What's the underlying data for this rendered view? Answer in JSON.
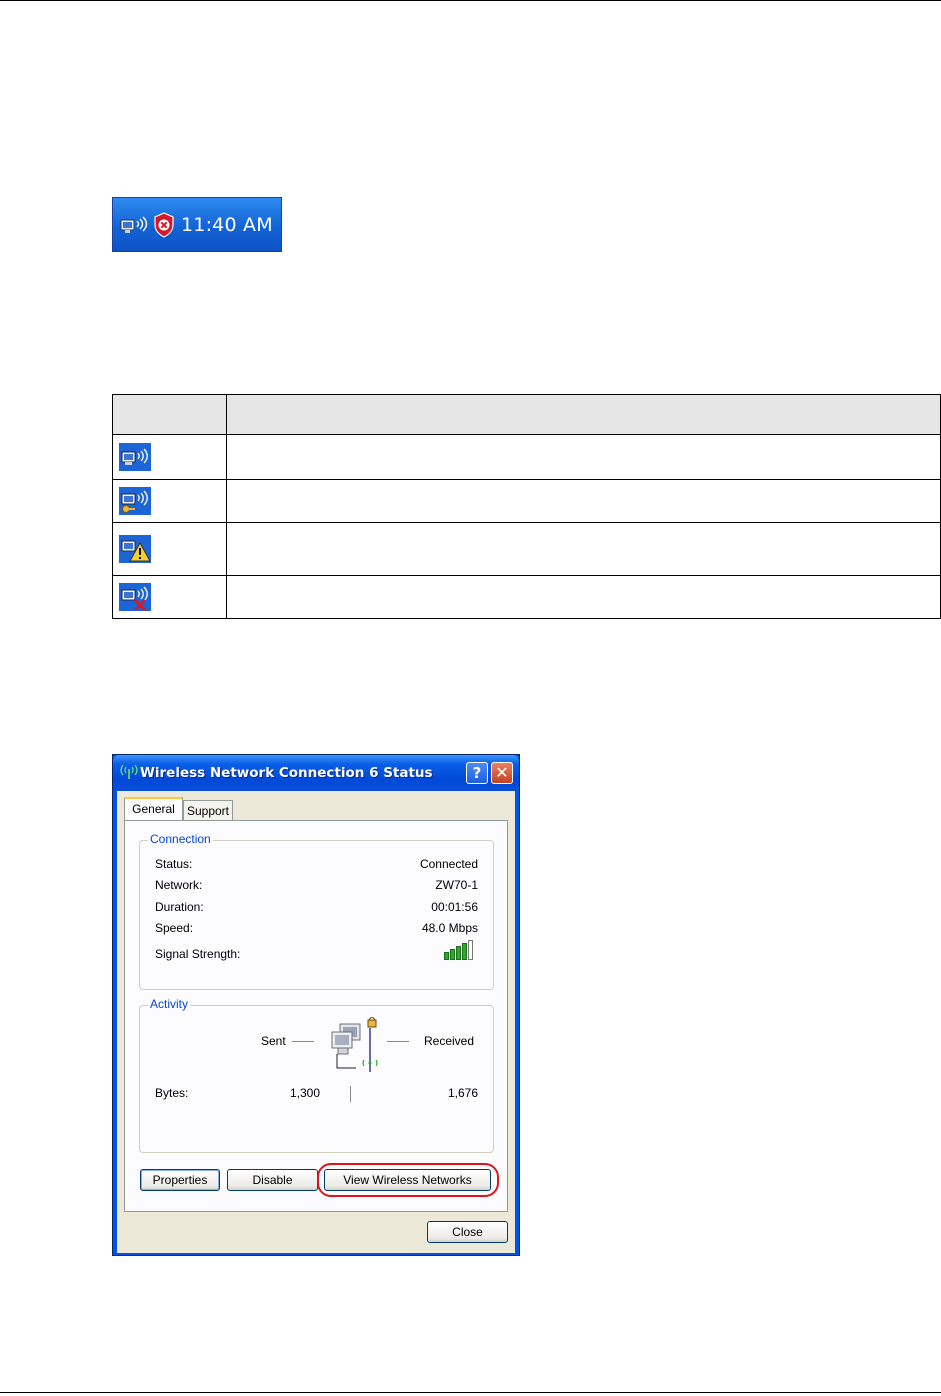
{
  "tray": {
    "clock": "11:40 AM"
  },
  "icon_table": {
    "rows": [
      {
        "icon": "wireless-connected-icon"
      },
      {
        "icon": "wireless-connecting-icon"
      },
      {
        "icon": "wireless-warning-icon"
      },
      {
        "icon": "wireless-disconnected-icon"
      }
    ]
  },
  "dialog": {
    "title": "Wireless Network Connection 6 Status",
    "tabs": [
      {
        "label": "General"
      },
      {
        "label": "Support"
      }
    ],
    "connection": {
      "legend": "Connection",
      "status_label": "Status:",
      "status_value": "Connected",
      "network_label": "Network:",
      "network_value": "ZW70-1",
      "duration_label": "Duration:",
      "duration_value": "00:01:56",
      "speed_label": "Speed:",
      "speed_value": "48.0 Mbps",
      "signal_label": "Signal Strength:",
      "signal_bars_filled": 4,
      "signal_bars_total": 5
    },
    "activity": {
      "legend": "Activity",
      "sent_label": "Sent",
      "received_label": "Received",
      "bytes_label": "Bytes:",
      "bytes_sent": "1,300",
      "bytes_received": "1,676"
    },
    "buttons": {
      "properties": "Properties",
      "disable": "Disable",
      "view_networks": "View Wireless Networks",
      "close": "Close"
    }
  },
  "colors": {
    "highlight": "#e0141e",
    "xp_blue": "#0054e3",
    "legend_blue": "#0046d5"
  }
}
